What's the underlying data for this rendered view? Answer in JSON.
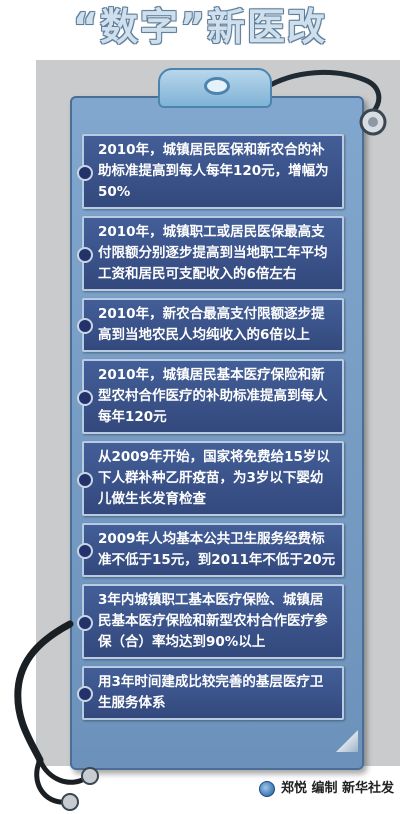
{
  "title": "“数字”新医改",
  "items": [
    "2010年，城镇居民医保和新农合的补助标准提高到每人每年120元，增幅为50%",
    "2010年，城镇职工或居民医保最高支付限额分别逐步提高到当地职工年平均工资和居民可支配收入的6倍左右",
    "2010年，新农合最高支付限额逐步提高到当地农民人均纯收入的6倍以上",
    "2010年，城镇居民基本医疗保险和新型农村合作医疗的补助标准提高到每人每年120元",
    "从2009年开始，国家将免费给15岁以下人群补种乙肝疫苗，为3岁以下婴幼儿做生长发育检查",
    "2009年人均基本公共卫生服务经费标准不低于15元，到2011年不低于20元",
    "3年内城镇职工基本医疗保险、城镇居民基本医疗保险和新型农村合作医疗参保（合）率均达到90%以上",
    "用3年时间建成比较完善的基层医疗卫生服务体系"
  ],
  "credit": "郑悦 编制 新华社发",
  "colors": {
    "card_bg": "#3a528a",
    "board_bg": "#7a9fc8",
    "panel_bg": "#c9cbcc",
    "title_fill": "#cfe0ec"
  },
  "icons": [
    "stethoscope-icon",
    "clipboard-clip-icon",
    "xinhua-logo-icon"
  ]
}
